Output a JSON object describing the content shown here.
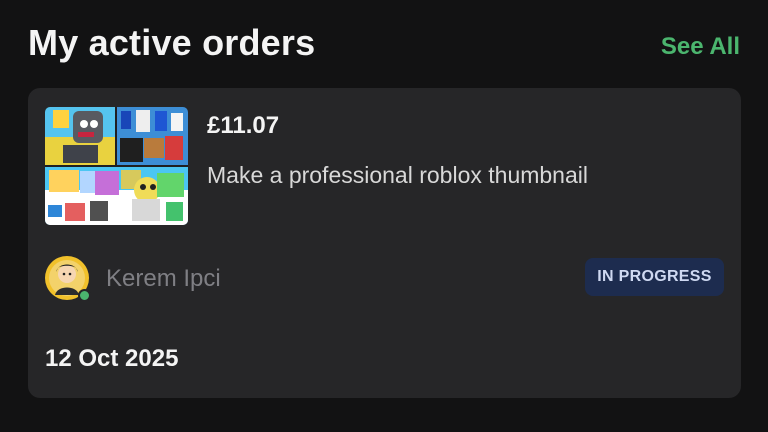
{
  "header": {
    "title": "My active orders",
    "see_all_label": "See All",
    "accent_color": "#4bb56e"
  },
  "order": {
    "price": "£11.07",
    "gig_title": "Make a professional roblox thumbnail",
    "thumbnail_icon": "roblox-thumbnail-collage",
    "seller": {
      "name": "Kerem Ipci",
      "avatar_icon": "seller-avatar",
      "online": true
    },
    "status": "IN PROGRESS",
    "status_color": "#1d2c4f",
    "date": "12 Oct 2025"
  }
}
